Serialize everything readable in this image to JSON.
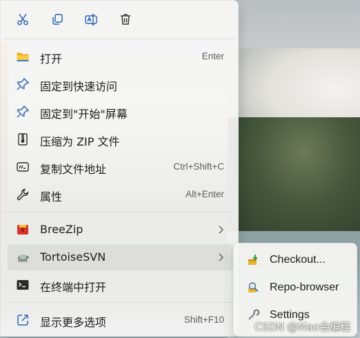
{
  "toolbar": {
    "cut": {
      "icon": "scissors-icon"
    },
    "copy": {
      "icon": "copy-icon"
    },
    "rename": {
      "icon": "rename-icon"
    },
    "delete": {
      "icon": "trash-icon"
    }
  },
  "menu": {
    "items": [
      {
        "label": "打开",
        "shortcut": "Enter",
        "icon": "folder-icon"
      },
      {
        "label": "固定到快速访问",
        "shortcut": "",
        "icon": "pin-icon"
      },
      {
        "label": "固定到\"开始\"屏幕",
        "shortcut": "",
        "icon": "pin-icon"
      },
      {
        "label": "压缩为 ZIP 文件",
        "shortcut": "",
        "icon": "zip-icon"
      },
      {
        "label": "复制文件地址",
        "shortcut": "Ctrl+Shift+C",
        "icon": "copy-path-icon"
      },
      {
        "label": "属性",
        "shortcut": "Alt+Enter",
        "icon": "wrench-icon"
      },
      {
        "label": "BreeZip",
        "shortcut": "",
        "icon": "breezip-icon",
        "has_submenu": true
      },
      {
        "label": "TortoiseSVN",
        "shortcut": "",
        "icon": "tortoise-icon",
        "has_submenu": true
      },
      {
        "label": "在终端中打开",
        "shortcut": "",
        "icon": "terminal-icon"
      },
      {
        "label": "显示更多选项",
        "shortcut": "Shift+F10",
        "icon": "external-icon"
      }
    ]
  },
  "submenu": {
    "items": [
      {
        "label": "Checkout...",
        "icon": "checkout-icon"
      },
      {
        "label": "Repo-browser",
        "icon": "repo-browser-icon"
      },
      {
        "label": "Settings",
        "icon": "settings-icon"
      }
    ]
  },
  "watermark": "CSDN @Mao会编程",
  "colors": {
    "accent": "#1f6fd1",
    "menu_bg": "#f8f8f6"
  }
}
